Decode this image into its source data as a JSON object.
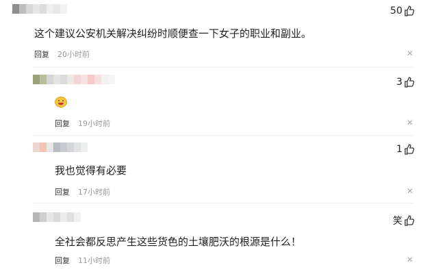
{
  "comments": [
    {
      "text": "这个建议公安机关解决纠纷时顺便查一下女子的职业和副业。",
      "reply_label": "回复",
      "time": "20小时前",
      "likes": "50"
    },
    {
      "text": "",
      "emoji": "laughing-emoji",
      "reply_label": "回复",
      "time": "19小时前",
      "likes": "3"
    },
    {
      "text": "我也觉得有必要",
      "reply_label": "回复",
      "time": "17小时前",
      "likes": "1"
    },
    {
      "text": "全社会都反思产生这些货色的土壤肥沃的根源是什么！",
      "reply_label": "回复",
      "time": "11小时前",
      "likes": "笑"
    }
  ],
  "colors": {
    "accent": "#222222",
    "meta": "#999999"
  }
}
